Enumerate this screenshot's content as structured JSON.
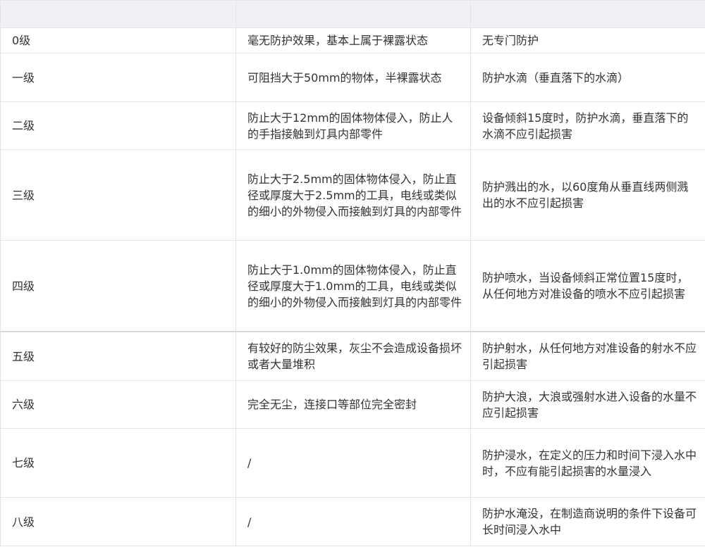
{
  "table": {
    "headers": [
      "",
      "",
      ""
    ],
    "rows": [
      {
        "level": "0级",
        "dust": "毫无防护效果，基本上属于裸露状态",
        "water": "无专门防护"
      },
      {
        "level": "一级",
        "dust": "可阻挡大于50mm的物体，半裸露状态",
        "water": "防护水滴（垂直落下的水滴）"
      },
      {
        "level": "二级",
        "dust": "防止大于12mm的固体物体侵入，防止人的手指接触到灯具内部零件",
        "water": "设备倾斜15度时，防护水滴，垂直落下的水滴不应引起损害"
      },
      {
        "level": "三级",
        "dust": "防止大于2.5mm的固体物体侵入，防止直径或厚度大于2.5mm的工具，电线或类似的细小的外物侵入而接触到灯具的内部零件",
        "water": "防护溅出的水，以60度角从垂直线两侧溅出的水不应引起损害"
      },
      {
        "level": "四级",
        "dust": "防止大于1.0mm的固体物体侵入，防止直径或厚度大于1.0mm的工具，电线或类似的细小的外物侵入而接触到灯具的内部零件",
        "water": "防护喷水，当设备倾斜正常位置15度时，从任何地方对准设备的喷水不应引起损害"
      },
      {
        "level": "五级",
        "dust": "有较好的防尘效果，灰尘不会造成设备损坏或者大量堆积",
        "water": "防护射水，从任何地方对准设备的射水不应引起损害"
      },
      {
        "level": "六级",
        "dust": "完全无尘，连接口等部位完全密封",
        "water": "防护大浪，大浪或强射水进入设备的水量不应引起损害"
      },
      {
        "level": "七级",
        "dust": "/",
        "water": "防护浸水，在定义的压力和时间下浸入水中时，不应有能引起损害的水量浸入"
      },
      {
        "level": "八级",
        "dust": "/",
        "water": "防护水淹没，在制造商说明的条件下设备可长时间浸入水中"
      }
    ]
  }
}
